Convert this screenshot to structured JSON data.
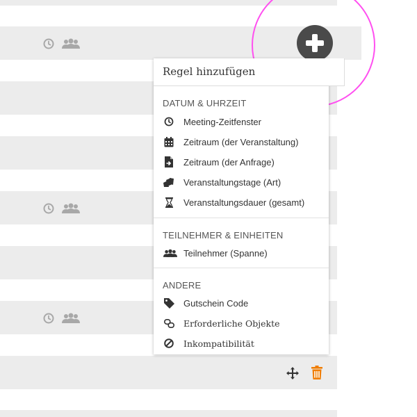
{
  "add_rule_menu": {
    "title": "Regel hinzufügen",
    "sections": [
      {
        "title": "DATUM & UHRZEIT",
        "items": [
          {
            "label": "Meeting-Zeitfenster",
            "icon": "clock-icon"
          },
          {
            "label": "Zeitraum (der Veranstaltung)",
            "icon": "calendar-icon"
          },
          {
            "label": "Zeitraum (der Anfrage)",
            "icon": "document-arrow-icon"
          },
          {
            "label": "Veranstaltungstage (Art)",
            "icon": "day-cards-icon"
          },
          {
            "label": "Veranstaltungsdauer (gesamt)",
            "icon": "hourglass-icon"
          }
        ]
      },
      {
        "title": "TEILNEHMER & EINHEITEN",
        "items": [
          {
            "label": "Teilnehmer (Spanne)",
            "icon": "people-icon"
          }
        ]
      },
      {
        "title": "ANDERE",
        "items": [
          {
            "label": "Gutschein Code",
            "icon": "tag-icon"
          },
          {
            "label": "Erforderliche Objekte",
            "icon": "link-icon"
          },
          {
            "label": "Inkompatibilität",
            "icon": "ban-icon"
          }
        ]
      }
    ]
  },
  "colors": {
    "stripe": "#ececec",
    "add_button": "#4a4a4a",
    "highlight_ring": "#ff4ff0",
    "delete_icon": "#f07d00",
    "row_icon": "#a8a8a8"
  }
}
